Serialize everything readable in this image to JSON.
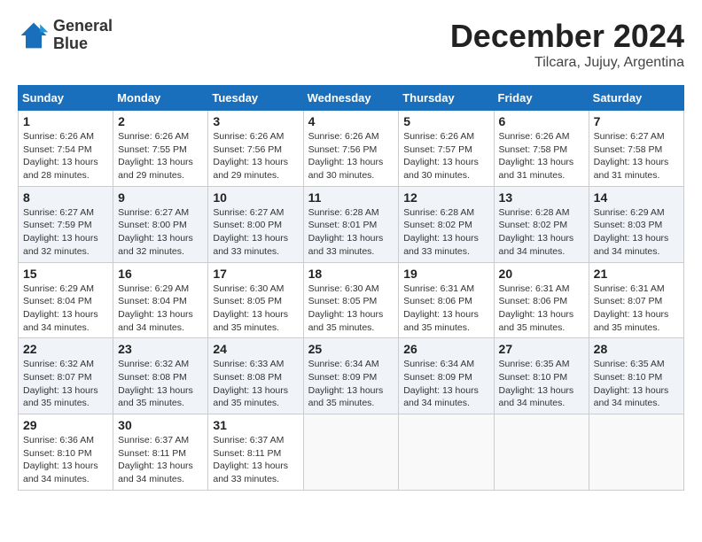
{
  "logo": {
    "line1": "General",
    "line2": "Blue"
  },
  "title": "December 2024",
  "subtitle": "Tilcara, Jujuy, Argentina",
  "weekdays": [
    "Sunday",
    "Monday",
    "Tuesday",
    "Wednesday",
    "Thursday",
    "Friday",
    "Saturday"
  ],
  "weeks": [
    [
      {
        "day": "1",
        "detail": "Sunrise: 6:26 AM\nSunset: 7:54 PM\nDaylight: 13 hours\nand 28 minutes."
      },
      {
        "day": "2",
        "detail": "Sunrise: 6:26 AM\nSunset: 7:55 PM\nDaylight: 13 hours\nand 29 minutes."
      },
      {
        "day": "3",
        "detail": "Sunrise: 6:26 AM\nSunset: 7:56 PM\nDaylight: 13 hours\nand 29 minutes."
      },
      {
        "day": "4",
        "detail": "Sunrise: 6:26 AM\nSunset: 7:56 PM\nDaylight: 13 hours\nand 30 minutes."
      },
      {
        "day": "5",
        "detail": "Sunrise: 6:26 AM\nSunset: 7:57 PM\nDaylight: 13 hours\nand 30 minutes."
      },
      {
        "day": "6",
        "detail": "Sunrise: 6:26 AM\nSunset: 7:58 PM\nDaylight: 13 hours\nand 31 minutes."
      },
      {
        "day": "7",
        "detail": "Sunrise: 6:27 AM\nSunset: 7:58 PM\nDaylight: 13 hours\nand 31 minutes."
      }
    ],
    [
      {
        "day": "8",
        "detail": "Sunrise: 6:27 AM\nSunset: 7:59 PM\nDaylight: 13 hours\nand 32 minutes."
      },
      {
        "day": "9",
        "detail": "Sunrise: 6:27 AM\nSunset: 8:00 PM\nDaylight: 13 hours\nand 32 minutes."
      },
      {
        "day": "10",
        "detail": "Sunrise: 6:27 AM\nSunset: 8:00 PM\nDaylight: 13 hours\nand 33 minutes."
      },
      {
        "day": "11",
        "detail": "Sunrise: 6:28 AM\nSunset: 8:01 PM\nDaylight: 13 hours\nand 33 minutes."
      },
      {
        "day": "12",
        "detail": "Sunrise: 6:28 AM\nSunset: 8:02 PM\nDaylight: 13 hours\nand 33 minutes."
      },
      {
        "day": "13",
        "detail": "Sunrise: 6:28 AM\nSunset: 8:02 PM\nDaylight: 13 hours\nand 34 minutes."
      },
      {
        "day": "14",
        "detail": "Sunrise: 6:29 AM\nSunset: 8:03 PM\nDaylight: 13 hours\nand 34 minutes."
      }
    ],
    [
      {
        "day": "15",
        "detail": "Sunrise: 6:29 AM\nSunset: 8:04 PM\nDaylight: 13 hours\nand 34 minutes."
      },
      {
        "day": "16",
        "detail": "Sunrise: 6:29 AM\nSunset: 8:04 PM\nDaylight: 13 hours\nand 34 minutes."
      },
      {
        "day": "17",
        "detail": "Sunrise: 6:30 AM\nSunset: 8:05 PM\nDaylight: 13 hours\nand 35 minutes."
      },
      {
        "day": "18",
        "detail": "Sunrise: 6:30 AM\nSunset: 8:05 PM\nDaylight: 13 hours\nand 35 minutes."
      },
      {
        "day": "19",
        "detail": "Sunrise: 6:31 AM\nSunset: 8:06 PM\nDaylight: 13 hours\nand 35 minutes."
      },
      {
        "day": "20",
        "detail": "Sunrise: 6:31 AM\nSunset: 8:06 PM\nDaylight: 13 hours\nand 35 minutes."
      },
      {
        "day": "21",
        "detail": "Sunrise: 6:31 AM\nSunset: 8:07 PM\nDaylight: 13 hours\nand 35 minutes."
      }
    ],
    [
      {
        "day": "22",
        "detail": "Sunrise: 6:32 AM\nSunset: 8:07 PM\nDaylight: 13 hours\nand 35 minutes."
      },
      {
        "day": "23",
        "detail": "Sunrise: 6:32 AM\nSunset: 8:08 PM\nDaylight: 13 hours\nand 35 minutes."
      },
      {
        "day": "24",
        "detail": "Sunrise: 6:33 AM\nSunset: 8:08 PM\nDaylight: 13 hours\nand 35 minutes."
      },
      {
        "day": "25",
        "detail": "Sunrise: 6:34 AM\nSunset: 8:09 PM\nDaylight: 13 hours\nand 35 minutes."
      },
      {
        "day": "26",
        "detail": "Sunrise: 6:34 AM\nSunset: 8:09 PM\nDaylight: 13 hours\nand 34 minutes."
      },
      {
        "day": "27",
        "detail": "Sunrise: 6:35 AM\nSunset: 8:10 PM\nDaylight: 13 hours\nand 34 minutes."
      },
      {
        "day": "28",
        "detail": "Sunrise: 6:35 AM\nSunset: 8:10 PM\nDaylight: 13 hours\nand 34 minutes."
      }
    ],
    [
      {
        "day": "29",
        "detail": "Sunrise: 6:36 AM\nSunset: 8:10 PM\nDaylight: 13 hours\nand 34 minutes."
      },
      {
        "day": "30",
        "detail": "Sunrise: 6:37 AM\nSunset: 8:11 PM\nDaylight: 13 hours\nand 34 minutes."
      },
      {
        "day": "31",
        "detail": "Sunrise: 6:37 AM\nSunset: 8:11 PM\nDaylight: 13 hours\nand 33 minutes."
      },
      null,
      null,
      null,
      null
    ]
  ]
}
